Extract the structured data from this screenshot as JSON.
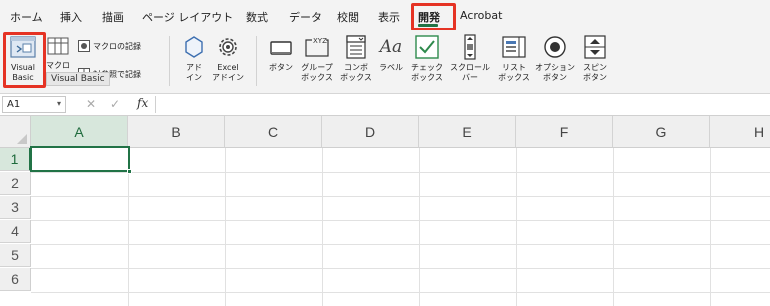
{
  "ribbon_tabs": [
    "ホーム",
    "挿入",
    "描画",
    "ページ レイアウト",
    "数式",
    "データ",
    "校閲",
    "表示",
    "開発",
    "Acrobat"
  ],
  "active_tab": "開発",
  "ribbon": {
    "visual_basic": [
      "Visual",
      "Basic"
    ],
    "macro_partial": "マクロ",
    "record_macro": "マクロの記録",
    "relative_ref": "対参照で記録",
    "addins": [
      "アド",
      "イン"
    ],
    "excel_addins": [
      "Excel",
      "アドイン"
    ],
    "button": "ボタン",
    "group_box": [
      "グループ",
      "ボックス"
    ],
    "combo_box": [
      "コンボ",
      "ボックス"
    ],
    "label": "ラベル",
    "check_box": [
      "チェック",
      "ボックス"
    ],
    "scroll_bar": [
      "スクロール",
      "バー"
    ],
    "list_box": [
      "リスト",
      "ボックス"
    ],
    "option_button": [
      "オプション",
      "ボタン"
    ],
    "spin_button": [
      "スピン",
      "ボタン"
    ],
    "label_glyph": "Aa",
    "group_box_glyph": "XYZ"
  },
  "tooltip": "Visual Basic",
  "formula_bar": {
    "name_box": "A1",
    "caret": "▾",
    "cancel": "✕",
    "enter": "✓",
    "fx": "fx",
    "formula": ""
  },
  "sheet": {
    "columns": [
      "A",
      "B",
      "C",
      "D",
      "E",
      "F",
      "G",
      "H"
    ],
    "rows": [
      "1",
      "2",
      "3",
      "4",
      "5",
      "6"
    ],
    "active_cell": "A1"
  },
  "colors": {
    "highlight": "#e53324",
    "accent": "#217346",
    "ribbon_bg": "#f3f3f3"
  }
}
